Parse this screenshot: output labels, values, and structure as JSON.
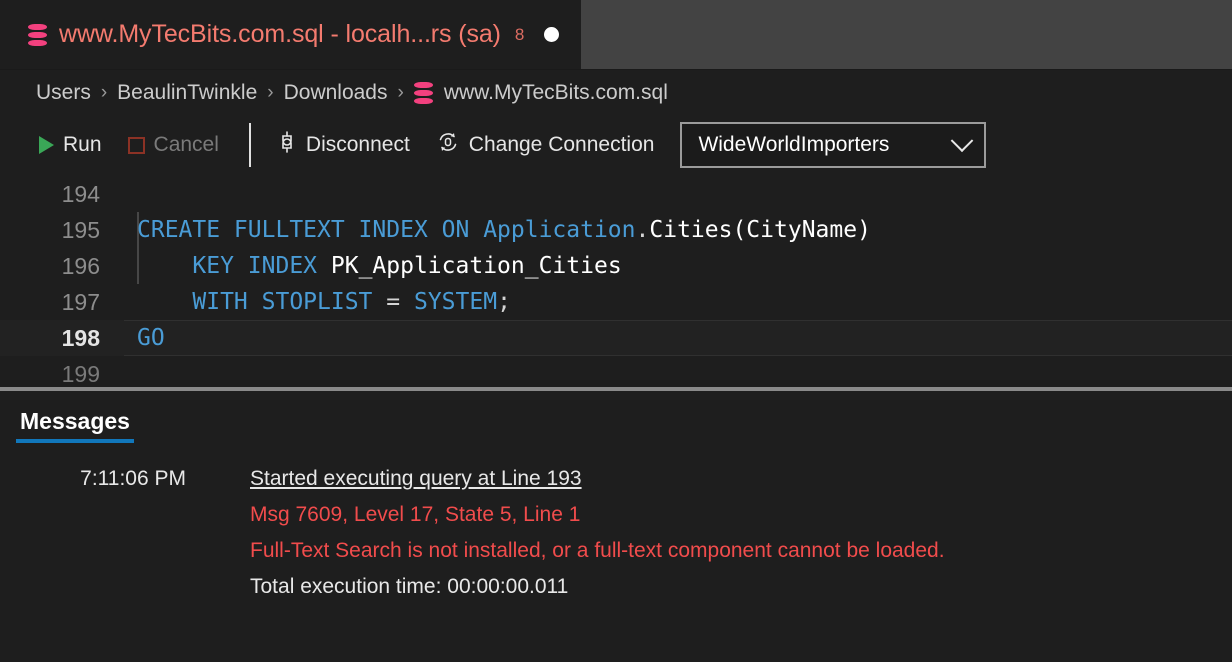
{
  "tab": {
    "icon": "database-icon",
    "title": "www.MyTecBits.com.sql - localh...rs (sa)",
    "count": "8",
    "dirty_indicator": "unsaved-dot"
  },
  "breadcrumb": {
    "items": [
      {
        "label": "Users"
      },
      {
        "label": "BeaulinTwinkle"
      },
      {
        "label": "Downloads"
      }
    ],
    "separator": "›",
    "file": {
      "icon": "database-icon",
      "label": "www.MyTecBits.com.sql"
    }
  },
  "toolbar": {
    "run_label": "Run",
    "cancel_label": "Cancel",
    "disconnect_label": "Disconnect",
    "change_connection_label": "Change Connection",
    "connection": {
      "value": "WideWorldImporters",
      "chevron": "chevron-down-icon"
    }
  },
  "editor": {
    "lines": [
      {
        "no": "194",
        "active": false,
        "dim": false,
        "tokens": []
      },
      {
        "no": "195",
        "active": false,
        "dim": false,
        "tokens": [
          {
            "t": "CREATE FULLTEXT INDEX ON ",
            "c": "kw"
          },
          {
            "t": "Application",
            "c": "obj"
          },
          {
            "t": ".",
            "c": "pun"
          },
          {
            "t": "Cities(CityName)",
            "c": "id"
          }
        ]
      },
      {
        "no": "196",
        "active": false,
        "dim": false,
        "tokens": [
          {
            "t": "    ",
            "c": "pun"
          },
          {
            "t": "KEY INDEX ",
            "c": "kw"
          },
          {
            "t": "PK_Application_Cities",
            "c": "id"
          }
        ]
      },
      {
        "no": "197",
        "active": false,
        "dim": false,
        "tokens": [
          {
            "t": "    ",
            "c": "pun"
          },
          {
            "t": "WITH STOPLIST ",
            "c": "kw"
          },
          {
            "t": "= ",
            "c": "pun"
          },
          {
            "t": "SYSTEM",
            "c": "kw"
          },
          {
            "t": ";",
            "c": "pun"
          }
        ]
      },
      {
        "no": "198",
        "active": true,
        "dim": false,
        "tokens": [
          {
            "t": "GO",
            "c": "kw"
          }
        ]
      },
      {
        "no": "199",
        "active": false,
        "dim": true,
        "tokens": []
      }
    ]
  },
  "panel": {
    "tabs": [
      {
        "label": "Messages",
        "active": true
      }
    ],
    "message": {
      "time": "7:11:06 PM",
      "lines": [
        {
          "text": "Started executing query at Line 193",
          "style": "link"
        },
        {
          "text": "Msg 7609, Level 17, State 5, Line 1",
          "style": "error"
        },
        {
          "text": "Full-Text Search is not installed, or a full-text component cannot be loaded.",
          "style": "error"
        },
        {
          "text": "Total execution time: 00:00:00.011",
          "style": "normal"
        }
      ]
    }
  },
  "colors": {
    "background": "#1e1e1e",
    "tabbar": "#434343",
    "tab_text": "#f47b6f",
    "accent": "#1177bb",
    "error": "#f14c4c",
    "keyword": "#4a9cd6",
    "db_icon": "#f3417f",
    "run_green": "#3aa757",
    "cancel_red": "#8c3225"
  }
}
